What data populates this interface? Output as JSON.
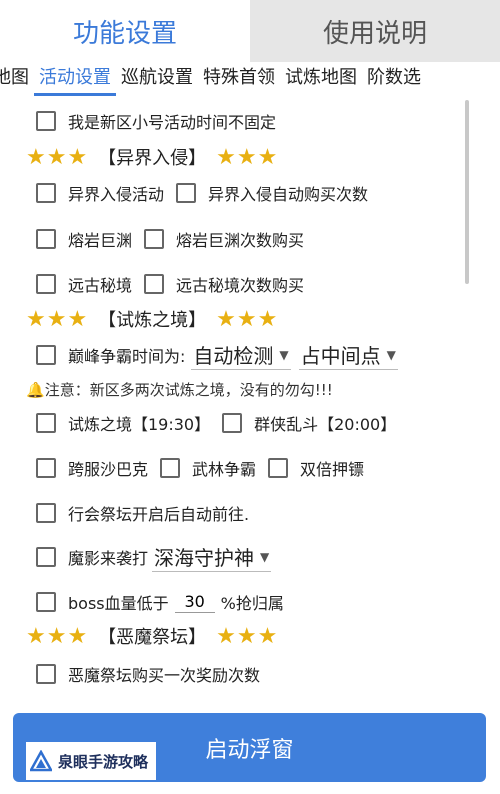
{
  "top_tabs": [
    {
      "label": "功能设置",
      "active": true
    },
    {
      "label": "使用说明",
      "active": false
    }
  ],
  "sub_tabs": [
    "地图",
    "活动设置",
    "巡航设置",
    "特殊首领",
    "试炼地图",
    "阶数选"
  ],
  "sub_tab_active": "活动设置",
  "options": {
    "newbie_time": "我是新区小号活动时间不固定",
    "invasion_activity": "异界入侵活动",
    "invasion_autobuy": "异界入侵自动购买次数",
    "lava_abyss": "熔岩巨渊",
    "lava_abyss_buy": "熔岩巨渊次数购买",
    "ancient_realm": "远古秘境",
    "ancient_realm_buy": "远古秘境次数购买",
    "peak_hegemony": "巅峰争霸时间为:",
    "trial_realm": "试炼之境【19:30】",
    "heroes_melee": "群侠乱斗【20:00】",
    "cross_sabak": "跨服沙巴克",
    "martial_hegemony": "武林争霸",
    "double_escort": "双倍押镖",
    "guild_altar": "行会祭坛开启后自动前往.",
    "shadow_raid": "魔影来袭打",
    "boss_hp_prefix": "boss血量低于",
    "boss_hp_suffix": "%抢归属",
    "demon_altar_buy": "恶魔祭坛购买一次奖励次数"
  },
  "sections": {
    "invasion": "【异界入侵】",
    "trial": "【试炼之境】",
    "demon_altar": "【恶魔祭坛】",
    "stars": "★★★"
  },
  "selects": {
    "peak_mode": "自动检测",
    "peak_point": "占中间点",
    "shadow_target": "深海守护神"
  },
  "boss_hp_value": "30",
  "notice": "注意：新区多两次试炼之境，没有的勿勾!!!",
  "start_button": "启动浮窗",
  "watermark": "泉眼手游攻略",
  "colors": {
    "accent": "#3b7ad9",
    "star": "#e8b012",
    "button": "#3f7fdb"
  }
}
